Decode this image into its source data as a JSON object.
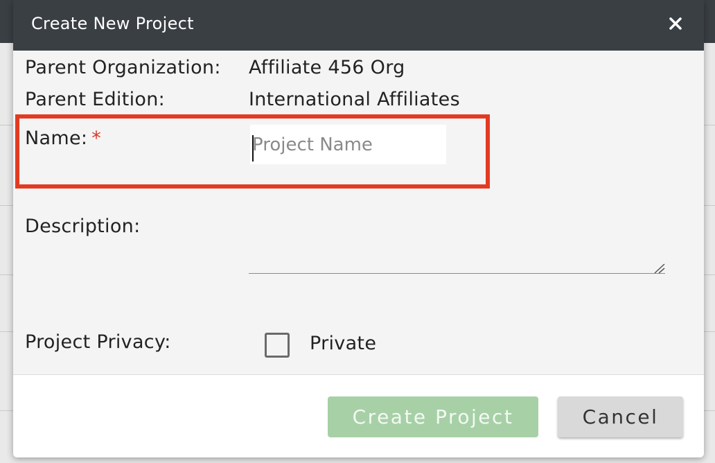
{
  "modal": {
    "title": "Create New Project",
    "close_icon": "close-icon"
  },
  "fields": {
    "parent_org_label": "Parent Organization:",
    "parent_org_value": "Affiliate 456 Org",
    "parent_edition_label": "Parent Edition:",
    "parent_edition_value": "International Affiliates",
    "name_label": "Name:",
    "name_required": "*",
    "name_placeholder": "Project Name",
    "name_value": "",
    "description_label": "Description:",
    "description_value": "",
    "privacy_label": "Project Privacy:",
    "privacy_option": "Private",
    "privacy_checked": false
  },
  "footer": {
    "create_label": "Create Project",
    "cancel_label": "Cancel"
  },
  "colors": {
    "header_bg": "#3a3f44",
    "required": "#d9372b",
    "highlight": "#e33b22",
    "create_button": "#a7d0a6",
    "cancel_button": "#d9d9d9"
  }
}
